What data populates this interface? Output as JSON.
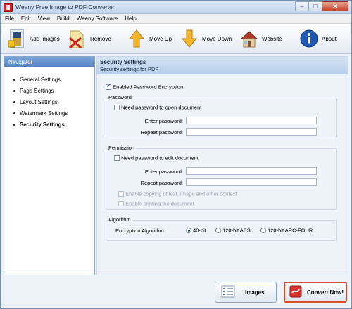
{
  "window": {
    "title": "Weeny Free Image to PDF Converter"
  },
  "menu": [
    "File",
    "Edit",
    "View",
    "Build",
    "Weeny Software",
    "Help"
  ],
  "toolbar": {
    "add_images": "Add Images",
    "remove": "Remove",
    "move_up": "Move Up",
    "move_down": "Move Down",
    "website": "Website",
    "about": "About"
  },
  "navigator": {
    "title": "Navigator",
    "items": [
      "General Settings",
      "Page Settings",
      "Layout Settings",
      "Watermark Settings",
      "Security Settings"
    ],
    "active": "Security Settings"
  },
  "security": {
    "title": "Security Settings",
    "subtitle": "Security settings for PDF",
    "enable_encryption": {
      "label": "Enabled Password Encryption",
      "checked": true
    },
    "password_group": {
      "title": "Password",
      "need_password": "Need password to open document",
      "enter_label": "Enter password:",
      "repeat_label": "Repeat password:",
      "enter_value": "",
      "repeat_value": ""
    },
    "permission_group": {
      "title": "Permission",
      "need_password": "Need password to edit document",
      "enter_label": "Enter password:",
      "repeat_label": "Repeat password:",
      "enter_value": "",
      "repeat_value": "",
      "enable_copying": "Enable copying of text, image and other context",
      "enable_printing": "Enable printing the document"
    },
    "algorithm_group": {
      "title": "Algorithm",
      "label": "Encryption Algorithm",
      "options": [
        "40-bit",
        "128-bit AES",
        "128-bit ARC-FOUR"
      ],
      "selected": "40-bit"
    }
  },
  "bottom": {
    "images_button": "Images",
    "convert_button": "Convert Now!"
  },
  "colors": {
    "accent": "#5783bd",
    "panel_bg": "#eef3fa",
    "convert_border": "#d4502e"
  }
}
